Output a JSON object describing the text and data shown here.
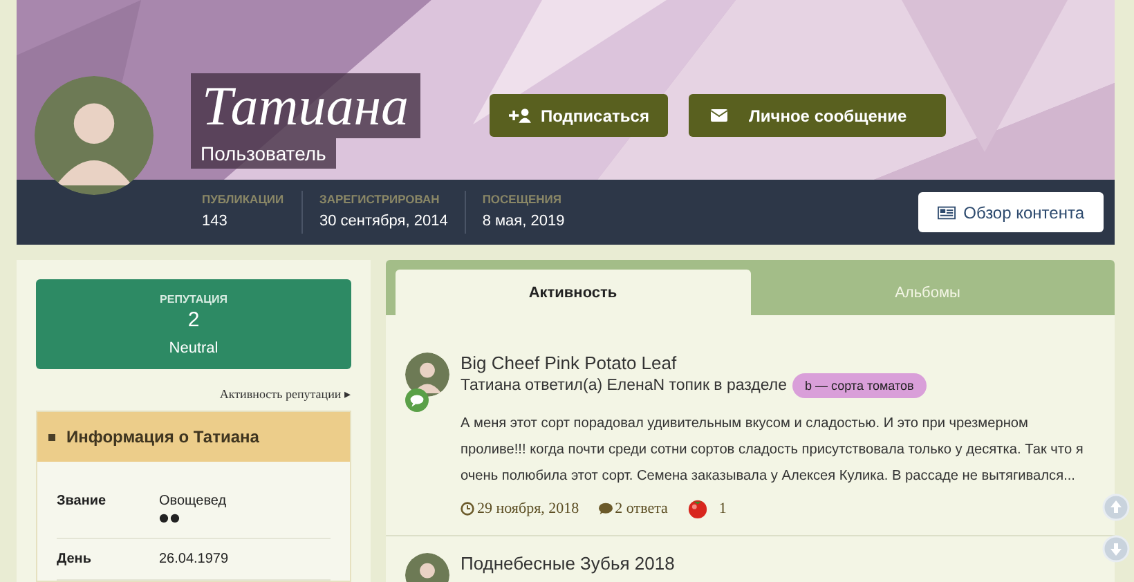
{
  "profile": {
    "name": "Татиана",
    "group": "Пользователь",
    "buttons": [
      {
        "kind": "follow",
        "label": "Подписаться"
      },
      {
        "kind": "message",
        "label": "Личное сообщение"
      }
    ],
    "stats": [
      {
        "label": "ПУБЛИКАЦИИ",
        "value": "143"
      },
      {
        "label": "ЗАРЕГИСТРИРОВАН",
        "value": "30 сентября, 2014"
      },
      {
        "label": "ПОСЕЩЕНИЯ",
        "value": "8 мая, 2019"
      }
    ],
    "content_button": "Обзор контента"
  },
  "reputation": {
    "title": "РЕПУТАЦИЯ",
    "value": "2",
    "level_text": "Neutral",
    "link": "Активность репутации ▸"
  },
  "about": {
    "title": "Информация о Татиана",
    "fields": [
      {
        "label": "Звание",
        "value": "Овощевед",
        "rank_dots": "●●"
      },
      {
        "label": "День",
        "value": "26.04.1979"
      }
    ]
  },
  "tabs": [
    {
      "label": "Активность",
      "selected": true
    },
    {
      "label": "Альбомы",
      "selected": false
    }
  ],
  "feed": [
    {
      "title": "Big Cheef Pink Potato Leaf",
      "meta": "Татиана ответил(а) ЕленаN топик в разделе",
      "tag": {
        "label": "b — сорта томатов",
        "color": "#d99fd9"
      },
      "body": "А меня этот сорт порадовал удивительным вкусом и сладостью. И это при чрезмерном проливе!!! когда почти среди сотни сортов сладость присутствовала только у десятка. Так что я очень полюбила этот сорт. Семена заказывала у Алексея Кулика. В рассаде не вытягивался...",
      "date": "29 ноября, 2018",
      "replies": "2 ответа",
      "reactions": "1"
    },
    {
      "title": "Поднебесные Зубья 2018"
    }
  ]
}
